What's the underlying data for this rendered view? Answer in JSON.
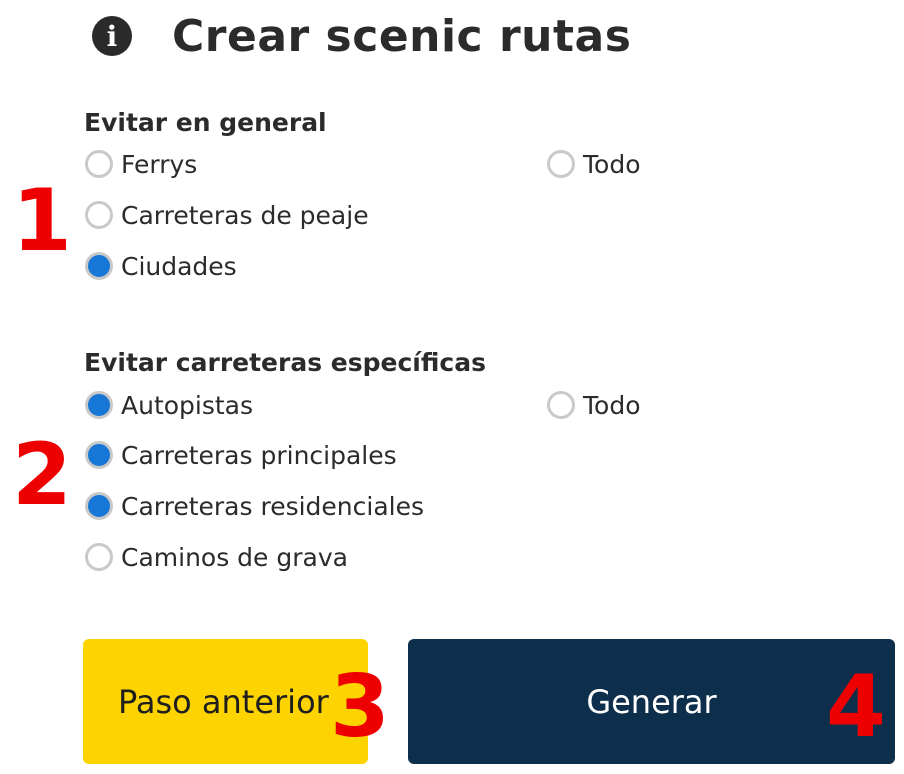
{
  "header": {
    "icon": "info-icon",
    "icon_glyph": "i",
    "title": "Crear scenic rutas"
  },
  "general": {
    "title": "Evitar en general",
    "options": [
      {
        "label": "Ferrys",
        "checked": false
      },
      {
        "label": "Carreteras de peaje",
        "checked": false
      },
      {
        "label": "Ciudades",
        "checked": true
      }
    ],
    "all": {
      "label": "Todo",
      "checked": false
    }
  },
  "specific": {
    "title": "Evitar carreteras específicas",
    "options": [
      {
        "label": "Autopistas",
        "checked": true
      },
      {
        "label": "Carreteras principales",
        "checked": true
      },
      {
        "label": "Carreteras residenciales",
        "checked": true
      },
      {
        "label": "Caminos de grava",
        "checked": false
      }
    ],
    "all": {
      "label": "Todo",
      "checked": false
    }
  },
  "buttons": {
    "previous": "Paso anterior",
    "generate": "Generar"
  },
  "annotations": {
    "m1": "1",
    "m2": "2",
    "m3": "3",
    "m4": "4",
    "color": "#ee0000"
  },
  "colors": {
    "radio_checked": "#1677d6",
    "radio_border": "#c9c9c9",
    "button_previous_bg": "#fdd400",
    "button_generate_bg": "#0e2f4b"
  }
}
